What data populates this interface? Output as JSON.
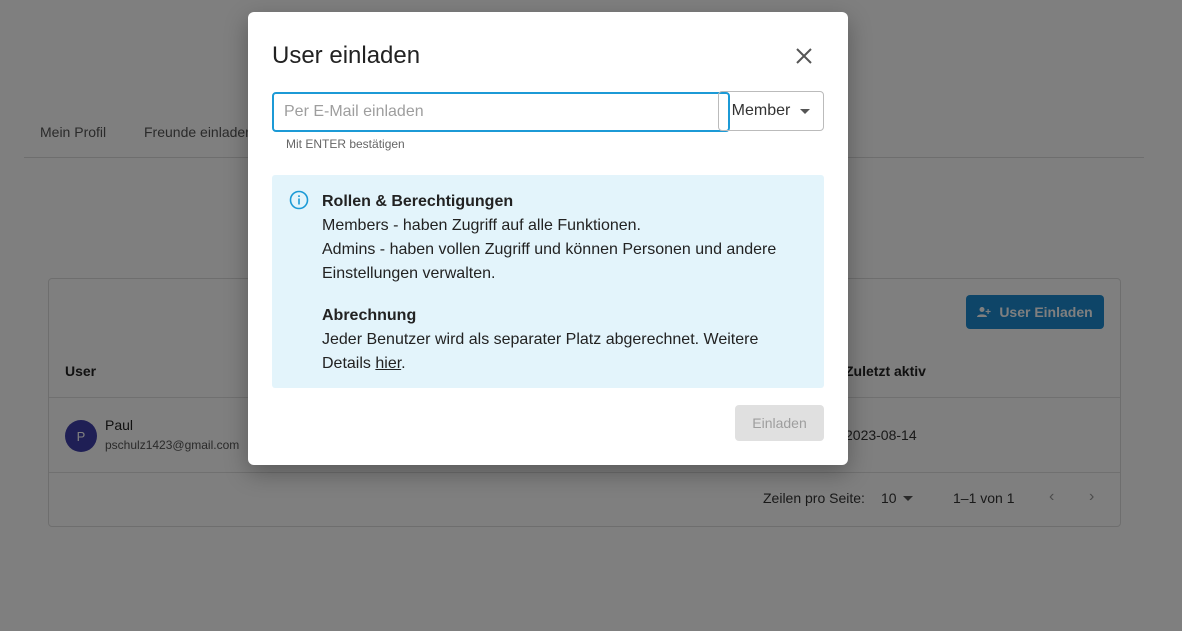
{
  "tabs": [
    "Mein Profil",
    "Freunde einladen"
  ],
  "table": {
    "invite_button": "User Einladen",
    "col_user": "User",
    "col_last_active": "Zuletzt aktiv",
    "rows": [
      {
        "avatar": "P",
        "name": "Paul",
        "email": "pschulz1423@gmail.com",
        "last_active": "2023-08-14"
      }
    ],
    "pagination": {
      "rows_label": "Zeilen pro Seite:",
      "rows_per_page": "10",
      "range": "1–1 von 1"
    }
  },
  "dialog": {
    "title": "User einladen",
    "email_placeholder": "Per E-Mail einladen",
    "role": "Member",
    "hint": "Mit ENTER bestätigen",
    "roles_title": "Rollen & Berechtigungen",
    "roles_members": "Members - haben Zugriff auf alle Funktionen.",
    "roles_admins": "Admins - haben vollen Zugriff und können Personen und andere Einstellungen verwalten.",
    "billing_title": "Abrechnung",
    "billing_text": "Jeder Benutzer wird als separater Platz abgerechnet. Weitere Details ",
    "billing_link": "hier",
    "billing_end": ".",
    "submit": "Einladen"
  },
  "colors": {
    "accent": "#1c9ad6",
    "info_bg": "#e3f4fb",
    "avatar": "#3f3faa"
  }
}
